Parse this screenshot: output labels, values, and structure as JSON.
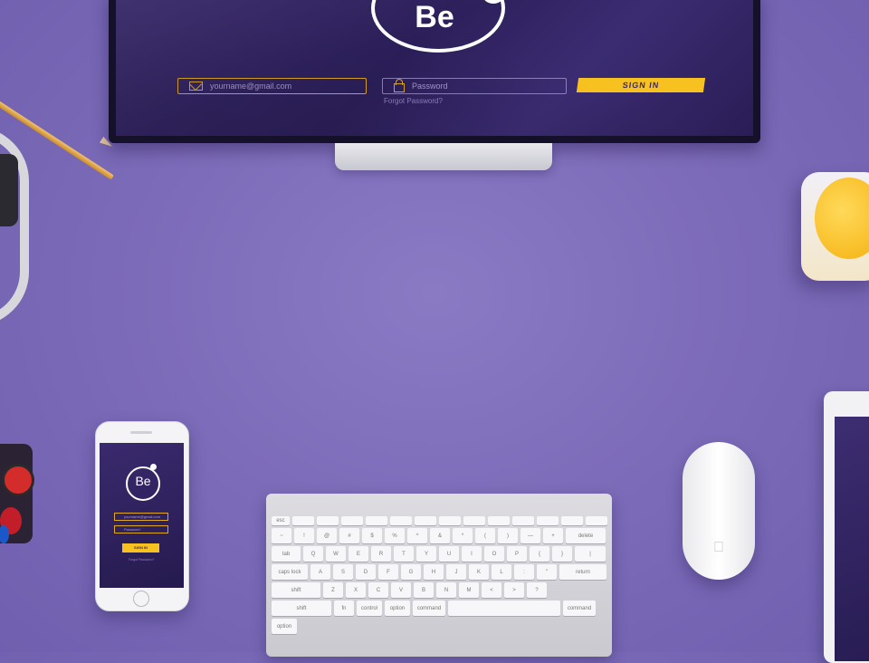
{
  "monitor_screen": {
    "logo_text": "Be",
    "email_placeholder": "yourname@gmail.com",
    "password_placeholder": "Password",
    "signin_label": "SIGN IN",
    "forgot_text": "Forgot Password?"
  },
  "phone_screen": {
    "logo_text": "Be",
    "email_placeholder": "yourname@gmail.com",
    "password_placeholder": "Password",
    "signin_label": "SIGN IN",
    "forgot_text": "Forgot Password?"
  },
  "colors": {
    "desk": "#7d6cb9",
    "screen": "#2c1f5a",
    "accent": "#f7c220"
  },
  "keyboard": {
    "fn_row": [
      "esc",
      "",
      "",
      "",
      "",
      "",
      "",
      "",
      "",
      "",
      "",
      "",
      "",
      ""
    ],
    "row1": [
      "~",
      "!",
      "@",
      "#",
      "$",
      "%",
      "^",
      "&",
      "*",
      "(",
      ")",
      "—",
      "+",
      "delete"
    ],
    "row2": [
      "tab",
      "Q",
      "W",
      "E",
      "R",
      "T",
      "Y",
      "U",
      "I",
      "O",
      "P",
      "{",
      "}",
      "|"
    ],
    "row3": [
      "caps lock",
      "A",
      "S",
      "D",
      "F",
      "G",
      "H",
      "J",
      "K",
      "L",
      ":",
      "\"",
      "return"
    ],
    "row4": [
      "shift",
      "Z",
      "X",
      "C",
      "V",
      "B",
      "N",
      "M",
      "<",
      ">",
      "?",
      "shift"
    ],
    "row5": [
      "fn",
      "control",
      "option",
      "command",
      "",
      "command",
      "option"
    ]
  }
}
